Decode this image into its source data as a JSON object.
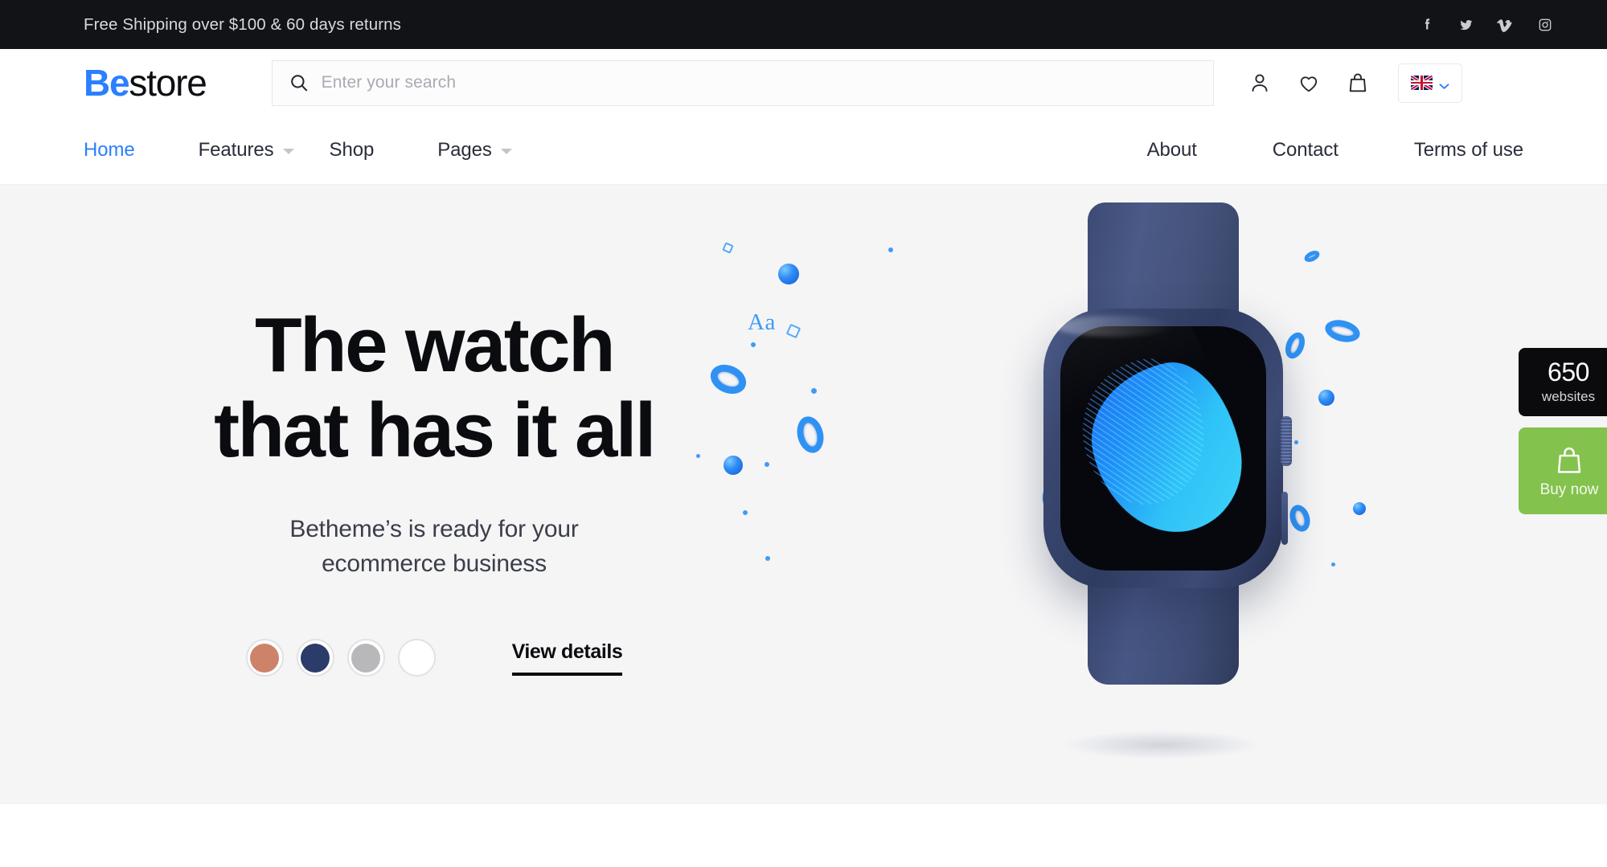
{
  "topbar": {
    "announcement": "Free Shipping over $100 & 60 days returns",
    "social": [
      {
        "name": "facebook-icon",
        "label": "Facebook"
      },
      {
        "name": "twitter-icon",
        "label": "Twitter"
      },
      {
        "name": "vimeo-icon",
        "label": "Vimeo"
      },
      {
        "name": "instagram-icon",
        "label": "Instagram"
      }
    ],
    "bg_color": "#111317"
  },
  "header": {
    "logo": {
      "accent_text": "Be",
      "rest_text": "store",
      "accent_color": "#2b7fff"
    },
    "search": {
      "placeholder": "Enter your search",
      "value": "",
      "icon": "search-icon"
    },
    "tools": [
      {
        "name": "account-icon",
        "label": "Account"
      },
      {
        "name": "wishlist-heart-icon",
        "label": "Wishlist"
      },
      {
        "name": "shopping-bag-icon",
        "label": "Cart"
      }
    ],
    "language": {
      "flag": "uk-flag",
      "code": "EN",
      "chevron": "chevron-down-icon"
    }
  },
  "nav": {
    "left": [
      {
        "label": "Home",
        "active": true,
        "has_submenu": false
      },
      {
        "label": "Features",
        "active": false,
        "has_submenu": true
      },
      {
        "label": "Shop",
        "active": false,
        "has_submenu": false
      },
      {
        "label": "Pages",
        "active": false,
        "has_submenu": true
      }
    ],
    "right": [
      {
        "label": "About"
      },
      {
        "label": "Contact"
      },
      {
        "label": "Terms of use"
      }
    ],
    "active_color": "#2b7fff"
  },
  "hero": {
    "title_line1": "The watch",
    "title_line2": "that has it all",
    "subtitle_line1": "Betheme’s is ready for your",
    "subtitle_line2": "ecommerce business",
    "cta_label": "View details",
    "bg_color": "#f5f5f6",
    "swatches": [
      {
        "name": "swatch-terracotta",
        "color": "#cd8369",
        "selected": false
      },
      {
        "name": "swatch-navy",
        "color": "#2b3c6b",
        "selected": false
      },
      {
        "name": "swatch-gray",
        "color": "#b8b8ba",
        "selected": false
      },
      {
        "name": "swatch-white",
        "color": "#ffffff",
        "selected": false
      }
    ],
    "product_image_alt": "Navy blue smartwatch with blue gradient watch face"
  },
  "side_widgets": {
    "count_badge": {
      "number": "650",
      "label": "websites",
      "bg_color": "#0b0b0d"
    },
    "buy_button": {
      "label": "Buy now",
      "icon": "shopping-bag-icon",
      "bg_color": "#83c24c"
    }
  }
}
